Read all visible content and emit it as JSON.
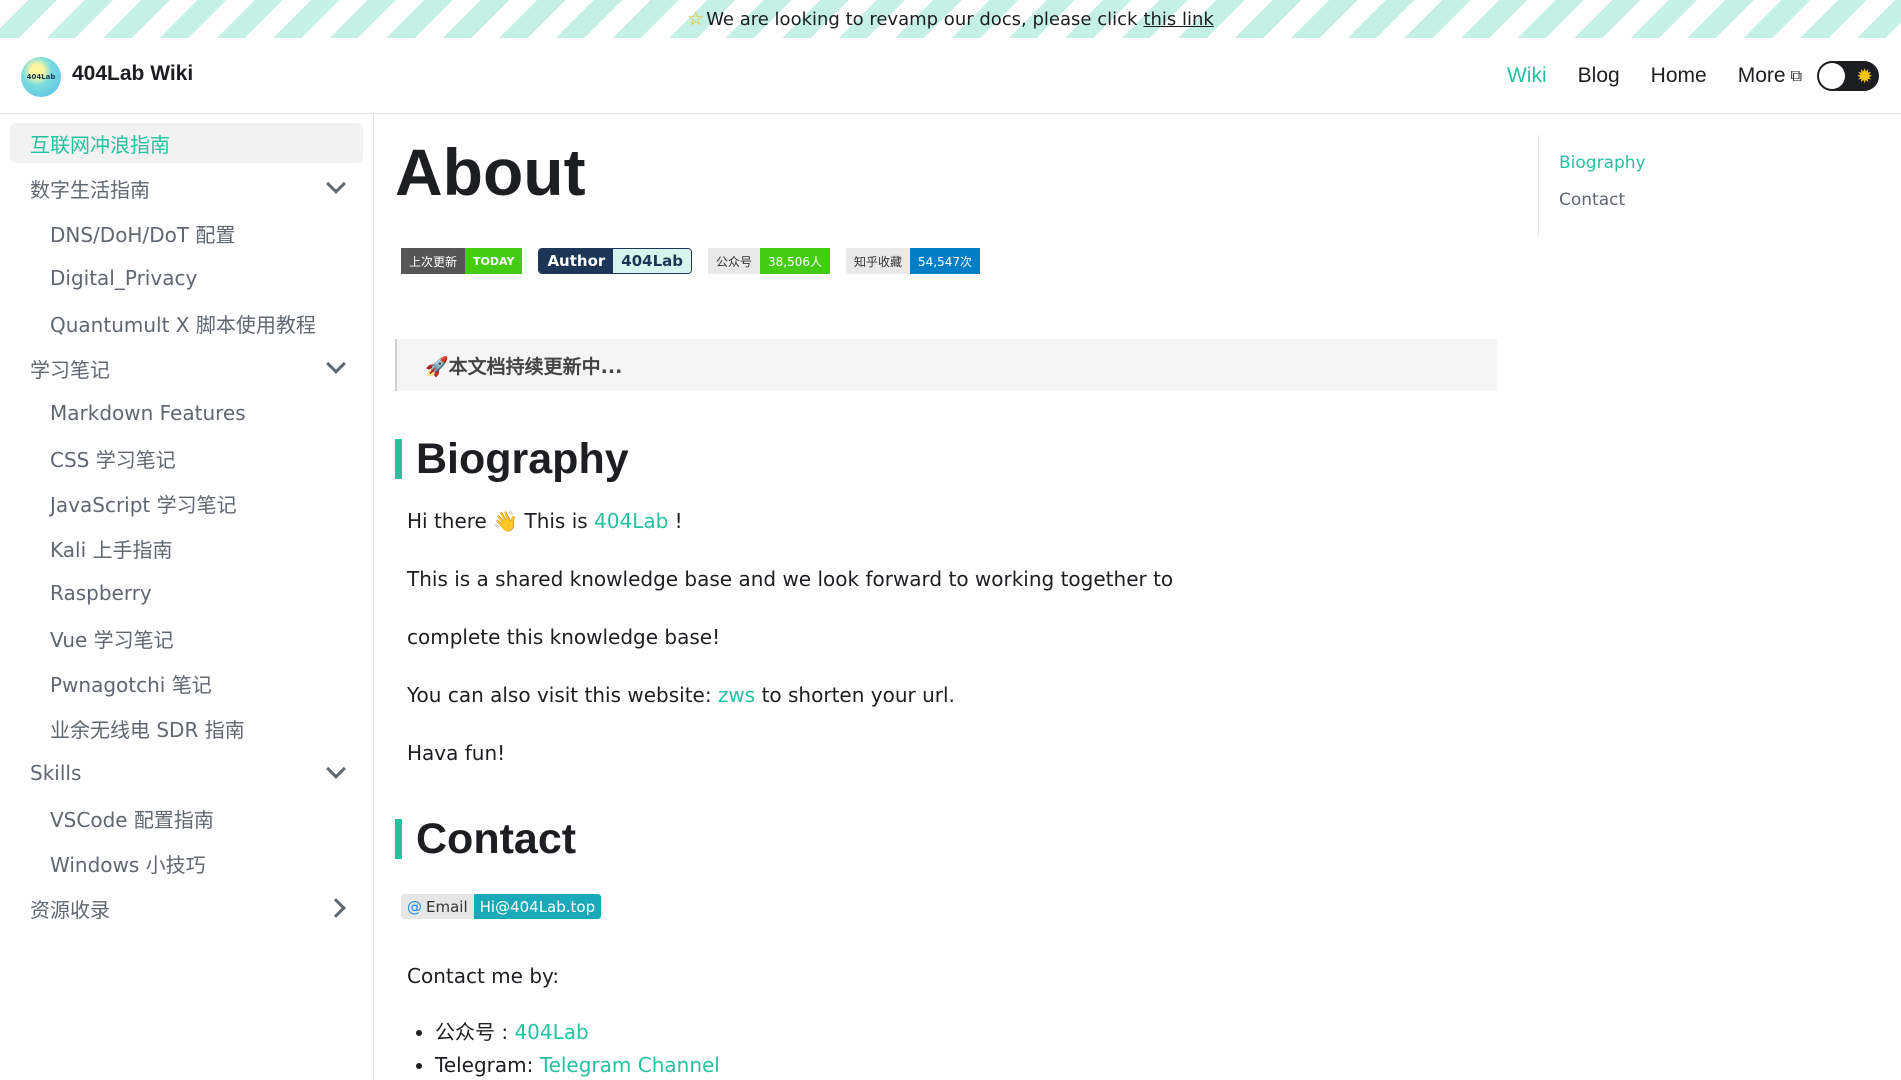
{
  "announcement": {
    "text": "We are looking to revamp our docs, please click",
    "link": "this link",
    "icon": "star-icon"
  },
  "navbar": {
    "brand": "404Lab Wiki",
    "logo_text": "404Lab",
    "links": [
      "Wiki",
      "Blog",
      "Home",
      "More"
    ],
    "active": "Wiki",
    "theme_toggle_icon": "sun-icon"
  },
  "sidebar": {
    "items": [
      {
        "label": "互联网冲浪指南",
        "active": true
      },
      {
        "label": "数字生活指南",
        "expandable": "expanded"
      },
      {
        "label": "DNS/DoH/DoT 配置",
        "sub": true
      },
      {
        "label": "Digital_Privacy",
        "sub": true
      },
      {
        "label": "Quantumult X 脚本使用教程",
        "sub": true
      },
      {
        "label": "学习笔记",
        "expandable": "expanded"
      },
      {
        "label": "Markdown Features",
        "sub": true
      },
      {
        "label": "CSS 学习笔记",
        "sub": true
      },
      {
        "label": "JavaScript 学习笔记",
        "sub": true
      },
      {
        "label": "Kali 上手指南",
        "sub": true
      },
      {
        "label": "Raspberry",
        "sub": true
      },
      {
        "label": "Vue 学习笔记",
        "sub": true
      },
      {
        "label": "Pwnagotchi 笔记",
        "sub": true
      },
      {
        "label": "业余无线电 SDR 指南",
        "sub": true
      },
      {
        "label": "Skills",
        "expandable": "expanded"
      },
      {
        "label": "VSCode 配置指南",
        "sub": true
      },
      {
        "label": "Windows 小技巧",
        "sub": true
      },
      {
        "label": "资源收录",
        "expandable": "collapsed"
      }
    ]
  },
  "main": {
    "title": "About",
    "badges": [
      {
        "left": "上次更新",
        "right": "TODAY",
        "color": "#4c1"
      },
      {
        "left": "Author",
        "right": "404Lab"
      },
      {
        "left": "公众号",
        "right": "38,506人",
        "color": "#4c1"
      },
      {
        "left": "知乎收藏",
        "right": "54,547次",
        "color": "#007ec6"
      }
    ],
    "callout": "🚀本文档持续更新中...",
    "biography": {
      "heading": "Biography",
      "greeting_pre": "Hi there 👋 This is ",
      "greeting_link": "404Lab",
      "greeting_post": " !",
      "line1": "This is a shared knowledge base and we look forward to working together to",
      "line2": "complete this knowledge base!",
      "visit_pre": "You can also visit this website: ",
      "visit_link": "zws",
      "visit_post": " to shorten your url.",
      "fun": "Hava fun!"
    },
    "contact": {
      "heading": "Contact",
      "email_label": "Email",
      "email_value": "Hi@404Lab.top",
      "intro": "Contact me by:",
      "items": [
        {
          "label": "公众号 : ",
          "link": "404Lab"
        },
        {
          "label": "Telegram: ",
          "link": "Telegram Channel"
        }
      ]
    }
  },
  "toc": {
    "items": [
      "Biography",
      "Contact"
    ],
    "active": "Biography"
  },
  "colors": {
    "accent": "#25c2a0",
    "text": "#1c1e21",
    "muted": "#606770"
  }
}
